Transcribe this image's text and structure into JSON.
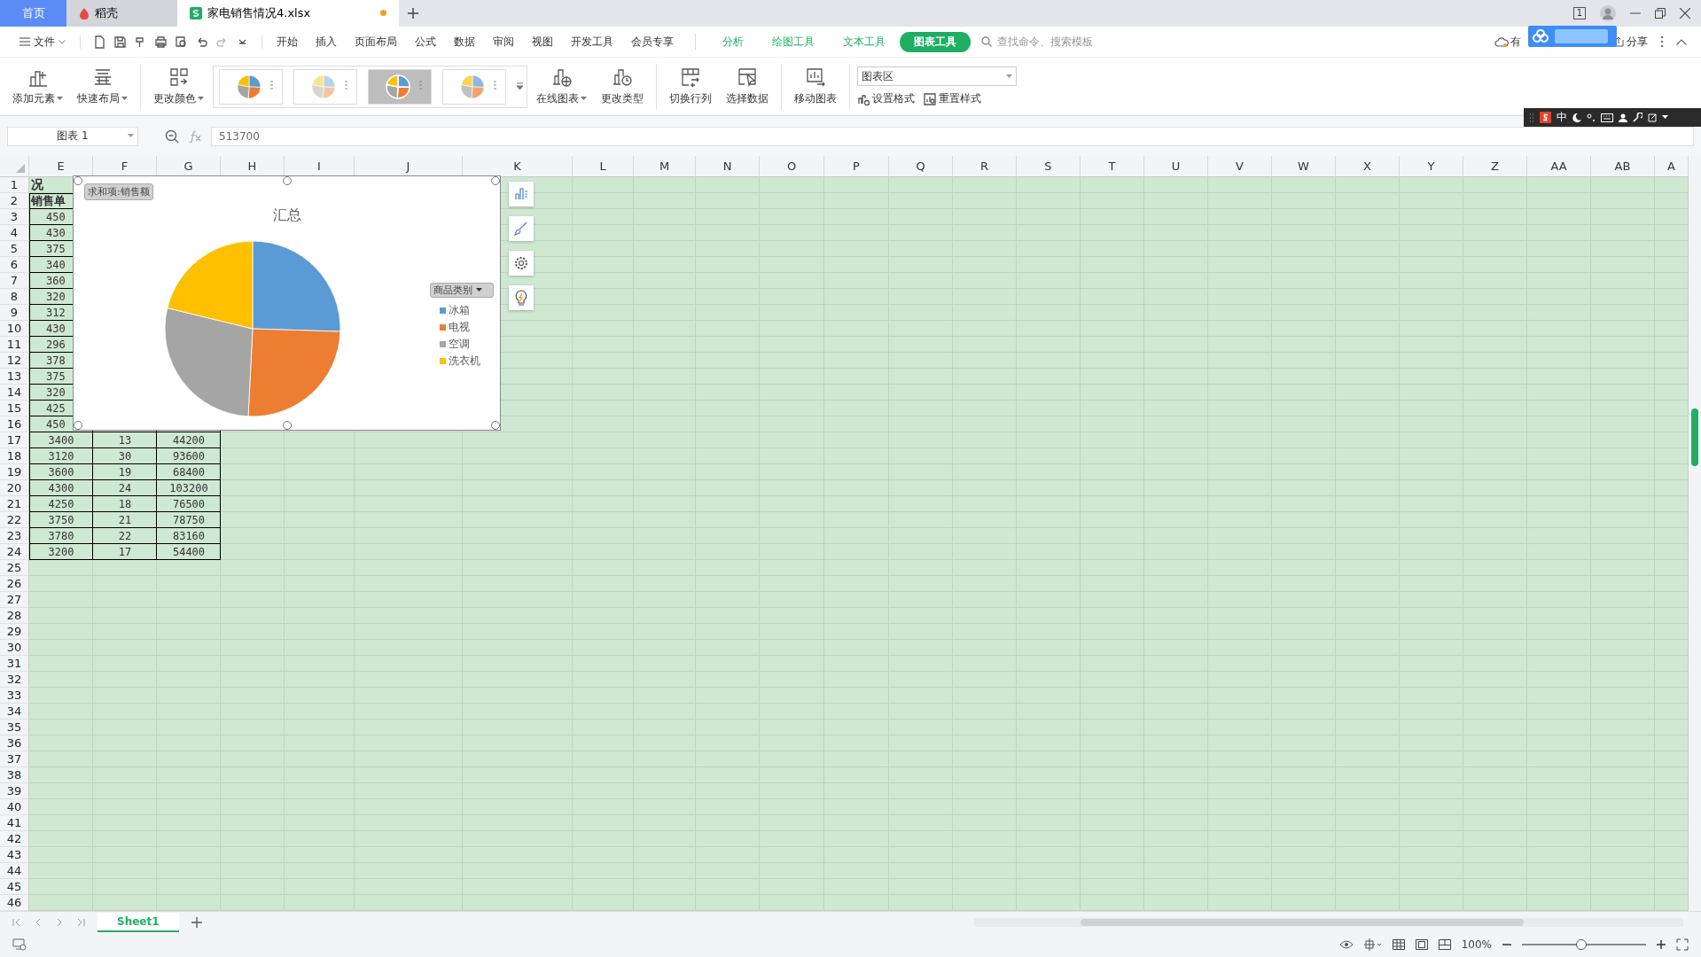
{
  "window": {
    "tile_badge": "1"
  },
  "tabs": [
    {
      "label": "首页",
      "kind": "home",
      "selected": false
    },
    {
      "label": "稻壳",
      "kind": "docer",
      "selected": false
    },
    {
      "label": "家电销售情况4.xlsx",
      "kind": "sheet",
      "selected": true,
      "unsaved": true
    }
  ],
  "menu": {
    "file": "文件",
    "tabs": [
      {
        "label": "开始",
        "kind": "main",
        "selected": false
      },
      {
        "label": "插入",
        "kind": "main",
        "selected": false
      },
      {
        "label": "页面布局",
        "kind": "main",
        "selected": false
      },
      {
        "label": "公式",
        "kind": "main",
        "selected": false
      },
      {
        "label": "数据",
        "kind": "main",
        "selected": false
      },
      {
        "label": "审阅",
        "kind": "main",
        "selected": false
      },
      {
        "label": "视图",
        "kind": "main",
        "selected": false
      },
      {
        "label": "开发工具",
        "kind": "main",
        "selected": false
      },
      {
        "label": "会员专享",
        "kind": "main",
        "selected": false
      },
      {
        "label": "分析",
        "kind": "context",
        "selected": false
      },
      {
        "label": "绘图工具",
        "kind": "context",
        "selected": false
      },
      {
        "label": "文本工具",
        "kind": "context",
        "selected": false
      },
      {
        "label": "图表工具",
        "kind": "context",
        "selected": true
      }
    ],
    "search": {
      "placeholder": "查找命令、搜索模板"
    },
    "cloud_status": "有",
    "share": "分享"
  },
  "ribbon": {
    "buttons_left": [
      {
        "label": "添加元素",
        "dropdown": true
      },
      {
        "label": "快速布局",
        "dropdown": true
      },
      {
        "label": "更改颜色",
        "dropdown": true
      }
    ],
    "styles": [
      {
        "selected": false
      },
      {
        "selected": false
      },
      {
        "selected": true
      },
      {
        "selected": false
      }
    ],
    "buttons_right": [
      {
        "label": "在线图表",
        "dropdown": true
      },
      {
        "label": "更改类型",
        "dropdown": false
      },
      {
        "label": "切换行列",
        "dropdown": false
      },
      {
        "label": "选择数据",
        "dropdown": false
      },
      {
        "label": "移动图表",
        "dropdown": false
      }
    ],
    "element_select": {
      "value": "图表区"
    },
    "small_buttons": [
      "设置格式",
      "重置样式"
    ]
  },
  "ime": {
    "mode": "中"
  },
  "formula_bar": {
    "name_box": "图表 1",
    "formula": "513700"
  },
  "sheet": {
    "columns": [
      "E",
      "F",
      "G",
      "H",
      "I",
      "J",
      "K",
      "L",
      "M",
      "N",
      "O",
      "P",
      "Q",
      "R",
      "S",
      "T",
      "U",
      "V",
      "W",
      "X",
      "Y",
      "Z",
      "AA",
      "AB",
      "A"
    ],
    "rows": [
      {
        "number": "1",
        "cells": [
          {
            "text": "况",
            "kind": "title"
          }
        ]
      },
      {
        "number": "2",
        "cells": [
          {
            "text": "销售单",
            "kind": "header"
          }
        ]
      },
      {
        "number": "3",
        "cells": [
          {
            "text": "450",
            "kind": "cut"
          }
        ]
      },
      {
        "number": "4",
        "cells": [
          {
            "text": "430",
            "kind": "cut"
          }
        ]
      },
      {
        "number": "5",
        "cells": [
          {
            "text": "375",
            "kind": "cut"
          }
        ]
      },
      {
        "number": "6",
        "cells": [
          {
            "text": "340",
            "kind": "cut"
          }
        ]
      },
      {
        "number": "7",
        "cells": [
          {
            "text": "360",
            "kind": "cut"
          }
        ]
      },
      {
        "number": "8",
        "cells": [
          {
            "text": "320",
            "kind": "cut"
          }
        ]
      },
      {
        "number": "9",
        "cells": [
          {
            "text": "312",
            "kind": "cut"
          }
        ]
      },
      {
        "number": "10",
        "cells": [
          {
            "text": "430",
            "kind": "cut"
          }
        ]
      },
      {
        "number": "11",
        "cells": [
          {
            "text": "296",
            "kind": "cut"
          }
        ]
      },
      {
        "number": "12",
        "cells": [
          {
            "text": "378",
            "kind": "cut"
          }
        ]
      },
      {
        "number": "13",
        "cells": [
          {
            "text": "375",
            "kind": "cut"
          }
        ]
      },
      {
        "number": "14",
        "cells": [
          {
            "text": "320",
            "kind": "cut"
          }
        ]
      },
      {
        "number": "15",
        "cells": [
          {
            "text": "425",
            "kind": "cut"
          }
        ]
      },
      {
        "number": "16",
        "cells": [
          {
            "text": "450",
            "kind": "cut"
          }
        ]
      },
      {
        "number": "17",
        "cells": [
          {
            "text": "3400",
            "kind": "value"
          },
          {
            "text": "13",
            "kind": "value"
          },
          {
            "text": "44200",
            "kind": "value"
          }
        ]
      },
      {
        "number": "18",
        "cells": [
          {
            "text": "3120",
            "kind": "value"
          },
          {
            "text": "30",
            "kind": "value"
          },
          {
            "text": "93600",
            "kind": "value"
          }
        ]
      },
      {
        "number": "19",
        "cells": [
          {
            "text": "3600",
            "kind": "value"
          },
          {
            "text": "19",
            "kind": "value"
          },
          {
            "text": "68400",
            "kind": "value"
          }
        ]
      },
      {
        "number": "20",
        "cells": [
          {
            "text": "4300",
            "kind": "value"
          },
          {
            "text": "24",
            "kind": "value"
          },
          {
            "text": "103200",
            "kind": "value"
          }
        ]
      },
      {
        "number": "21",
        "cells": [
          {
            "text": "4250",
            "kind": "value"
          },
          {
            "text": "18",
            "kind": "value"
          },
          {
            "text": "76500",
            "kind": "value"
          }
        ]
      },
      {
        "number": "22",
        "cells": [
          {
            "text": "3750",
            "kind": "value"
          },
          {
            "text": "21",
            "kind": "value"
          },
          {
            "text": "78750",
            "kind": "value"
          }
        ]
      },
      {
        "number": "23",
        "cells": [
          {
            "text": "3780",
            "kind": "value"
          },
          {
            "text": "22",
            "kind": "value"
          },
          {
            "text": "83160",
            "kind": "value"
          }
        ]
      },
      {
        "number": "24",
        "cells": [
          {
            "text": "3200",
            "kind": "value"
          },
          {
            "text": "17",
            "kind": "value"
          },
          {
            "text": "54400",
            "kind": "value"
          }
        ]
      },
      {
        "number": "25"
      },
      {
        "number": "26"
      },
      {
        "number": "27"
      },
      {
        "number": "28"
      },
      {
        "number": "29"
      },
      {
        "number": "30"
      },
      {
        "number": "31"
      },
      {
        "number": "32"
      },
      {
        "number": "33"
      },
      {
        "number": "34"
      },
      {
        "number": "35"
      },
      {
        "number": "36"
      },
      {
        "number": "37"
      },
      {
        "number": "38"
      },
      {
        "number": "39"
      },
      {
        "number": "40"
      },
      {
        "number": "41"
      },
      {
        "number": "42"
      },
      {
        "number": "43"
      },
      {
        "number": "44"
      },
      {
        "number": "45"
      },
      {
        "number": "46"
      }
    ]
  },
  "chart": {
    "badge": "求和项:销售额",
    "title": "汇总",
    "field_button": "商品类别",
    "legend": [
      {
        "label": "冰箱",
        "color": "#5b9bd5"
      },
      {
        "label": "电视",
        "color": "#ed7d31"
      },
      {
        "label": "空调",
        "color": "#a5a5a5"
      },
      {
        "label": "洗衣机",
        "color": "#ffc000"
      }
    ]
  },
  "sheet_tabs": [
    {
      "label": "Sheet1",
      "selected": true
    }
  ],
  "status_bar": {
    "zoom": "100%",
    "zoom_slider": {
      "level": 0.48
    }
  }
}
